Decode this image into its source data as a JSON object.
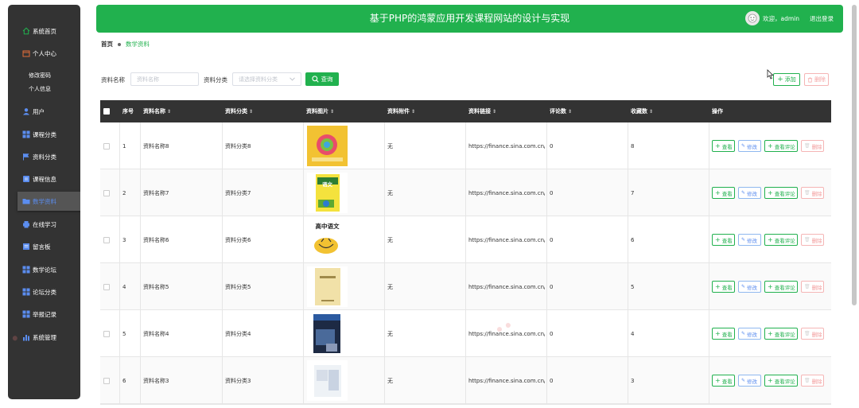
{
  "app": {
    "title": "基于PHP的鸿蒙应用开发课程网站的设计与实现",
    "welcome": "欢迎，admin",
    "logout": "退出登录"
  },
  "sidebar": {
    "items": [
      {
        "label": "系统首页",
        "icon": "home-icon"
      },
      {
        "label": "个人中心",
        "icon": "calendar-icon"
      },
      {
        "label": "用户",
        "icon": "user-icon"
      },
      {
        "label": "课程分类",
        "icon": "grid-icon"
      },
      {
        "label": "资料分类",
        "icon": "flag-icon"
      },
      {
        "label": "课程信息",
        "icon": "book-icon"
      },
      {
        "label": "数学资料",
        "icon": "folder-icon"
      },
      {
        "label": "在线学习",
        "icon": "printer-icon"
      },
      {
        "label": "留言板",
        "icon": "message-icon"
      },
      {
        "label": "数学论坛",
        "icon": "grid-icon"
      },
      {
        "label": "论坛分类",
        "icon": "grid-icon"
      },
      {
        "label": "举报记录",
        "icon": "grid-icon"
      },
      {
        "label": "系统管理",
        "icon": "chart-icon"
      }
    ],
    "subitems": [
      {
        "label": "修改密码"
      },
      {
        "label": "个人信息"
      }
    ],
    "active_index": 6
  },
  "breadcrumb": {
    "home": "首页",
    "current": "数学资料"
  },
  "search": {
    "name_label": "资料名称",
    "name_placeholder": "资料名称",
    "category_label": "资料分类",
    "category_placeholder": "请选择资料分类",
    "search_button": "查询",
    "add_button": "添加",
    "delete_button": "删除"
  },
  "table": {
    "columns": [
      "序号",
      "资料名称",
      "资料分类",
      "资料图片",
      "资料附件",
      "资料链接",
      "评论数",
      "收藏数",
      "操作"
    ],
    "row_actions": {
      "view": "查看",
      "edit": "修改",
      "comments": "查看评论",
      "delete": "删除"
    },
    "rows": [
      {
        "no": "1",
        "name": "资料名称8",
        "category": "资料分类8",
        "attachment": "无",
        "link": "https://finance.sina.com.cn/",
        "comments": "0",
        "favorites": "8",
        "image": "colorful-book-cover"
      },
      {
        "no": "2",
        "name": "资料名称7",
        "category": "资料分类7",
        "attachment": "无",
        "link": "https://finance.sina.com.cn/",
        "comments": "0",
        "favorites": "7",
        "image": "chinese-textbook-cover",
        "image_text": "语文"
      },
      {
        "no": "3",
        "name": "资料名称6",
        "category": "资料分类6",
        "attachment": "无",
        "link": "https://finance.sina.com.cn/",
        "comments": "0",
        "favorites": "6",
        "image": "chinese-cartoon",
        "image_text": "高中语文"
      },
      {
        "no": "4",
        "name": "资料名称5",
        "category": "资料分类5",
        "attachment": "无",
        "link": "https://finance.sina.com.cn/",
        "comments": "0",
        "favorites": "5",
        "image": "beige-book-cover"
      },
      {
        "no": "5",
        "name": "资料名称4",
        "category": "资料分类4",
        "attachment": "无",
        "link": "https://finance.sina.com.cn/",
        "comments": "0",
        "favorites": "4",
        "image": "dark-blue-book-cover"
      },
      {
        "no": "6",
        "name": "资料名称3",
        "category": "资料分类3",
        "attachment": "无",
        "link": "https://finance.sina.com.cn/",
        "comments": "0",
        "favorites": "3",
        "image": "light-book-cover"
      }
    ]
  },
  "colors": {
    "accent": "#21b14e",
    "sidebar_bg": "#333333",
    "header_bg": "#21b14e",
    "table_header_bg": "#333333",
    "delete": "#f29a9a",
    "edit": "#5b8def"
  }
}
